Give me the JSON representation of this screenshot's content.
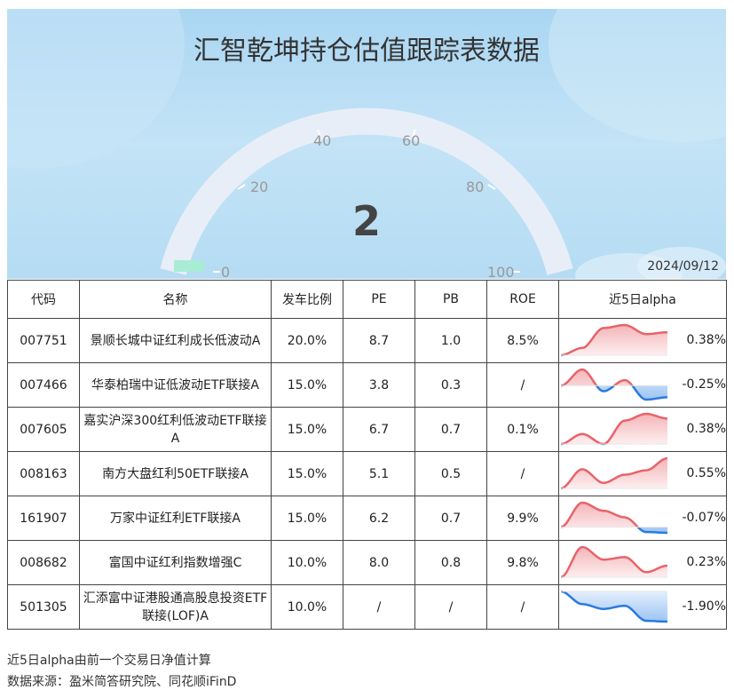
{
  "title": "汇智乾坤持仓估值跟踪表数据",
  "gauge": {
    "value": "2",
    "ticks": [
      "0",
      "20",
      "40",
      "60",
      "80",
      "100"
    ],
    "date": "2024/09/12"
  },
  "columns": [
    "代码",
    "名称",
    "发车比例",
    "PE",
    "PB",
    "ROE",
    "近5日alpha"
  ],
  "rows": [
    {
      "code": "007751",
      "name": "景顺长城中证红利成长低波动A",
      "ratio": "20.0%",
      "pe": "8.7",
      "pb": "1.0",
      "roe": "8.5%",
      "alpha": "0.38%",
      "trend": [
        0.0,
        0.12,
        0.45,
        0.5,
        0.35,
        0.38
      ]
    },
    {
      "code": "007466",
      "name": "华泰柏瑞中证低波动ETF联接A",
      "ratio": "15.0%",
      "pe": "3.8",
      "pb": "0.3",
      "roe": "/",
      "alpha": "-0.25%",
      "trend": [
        0.0,
        0.35,
        -0.12,
        0.12,
        -0.3,
        -0.25
      ]
    },
    {
      "code": "007605",
      "name": "嘉实沪深300红利低波动ETF联接A",
      "ratio": "15.0%",
      "pe": "6.7",
      "pb": "0.7",
      "roe": "0.1%",
      "alpha": "0.38%",
      "trend": [
        0.0,
        0.15,
        0.0,
        0.35,
        0.45,
        0.38
      ]
    },
    {
      "code": "008163",
      "name": "南方大盘红利50ETF联接A",
      "ratio": "15.0%",
      "pe": "5.1",
      "pb": "0.5",
      "roe": "/",
      "alpha": "0.55%",
      "trend": [
        0.0,
        0.35,
        0.1,
        0.25,
        0.33,
        0.55
      ]
    },
    {
      "code": "161907",
      "name": "万家中证红利ETF联接A",
      "ratio": "15.0%",
      "pe": "6.2",
      "pb": "0.7",
      "roe": "9.9%",
      "alpha": "-0.07%",
      "trend": [
        0.0,
        0.3,
        0.2,
        0.12,
        -0.06,
        -0.07
      ]
    },
    {
      "code": "008682",
      "name": "富国中证红利指数增强C",
      "ratio": "10.0%",
      "pe": "8.0",
      "pb": "0.8",
      "roe": "9.8%",
      "alpha": "0.23%",
      "trend": [
        0.0,
        0.6,
        0.35,
        0.4,
        0.1,
        0.23
      ]
    },
    {
      "code": "501305",
      "name": "汇添富中证港股通高股息投资ETF联接(LOF)A",
      "ratio": "10.0%",
      "pe": "/",
      "pb": "/",
      "roe": "/",
      "alpha": "-1.90%",
      "trend": [
        0.0,
        -0.8,
        -1.1,
        -0.9,
        -1.85,
        -1.9
      ]
    }
  ],
  "notes": [
    "近5日alpha由前一个交易日净值计算",
    "数据来源：盈米简答研究院、同花顺iFinD"
  ],
  "colors": {
    "positive": "#e8636b",
    "positive_fill": "#f4b4b8",
    "negative": "#2a79e0",
    "negative_fill": "#9cc4f3"
  }
}
